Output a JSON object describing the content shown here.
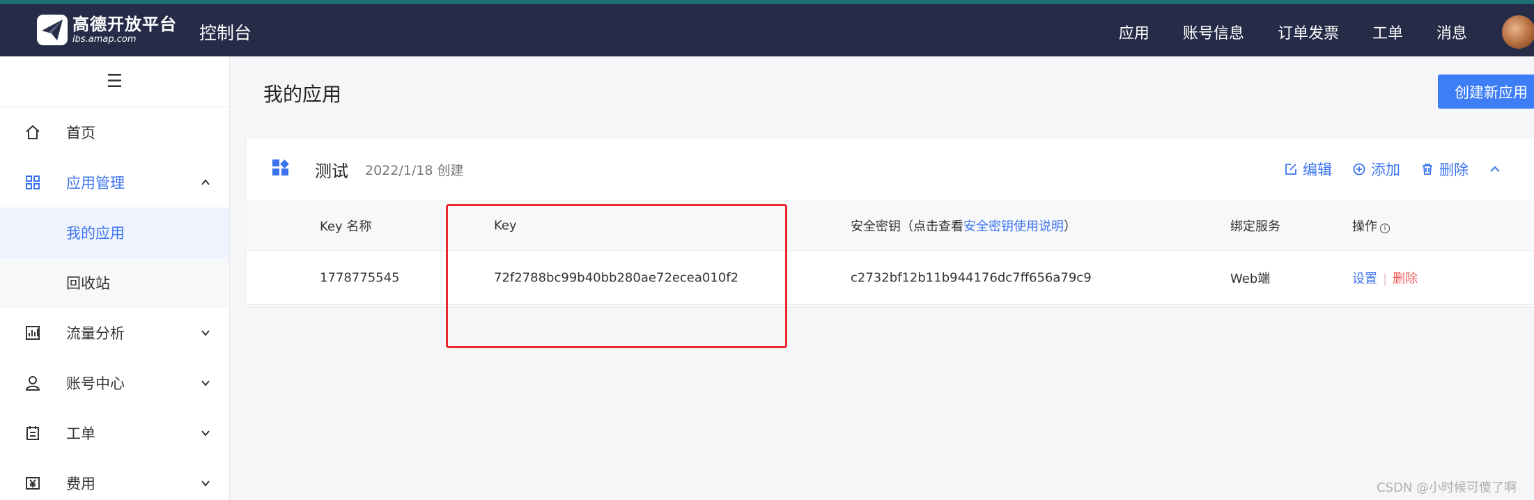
{
  "header": {
    "logo_cn": "高德开放平台",
    "logo_en": "lbs.amap.com",
    "console": "控制台",
    "nav": [
      "应用",
      "账号信息",
      "订单发票",
      "工单",
      "消息"
    ]
  },
  "sidebar": {
    "items": [
      {
        "label": "首页",
        "icon": "home-icon"
      },
      {
        "label": "应用管理",
        "icon": "apps-grid-icon"
      },
      {
        "label": "我的应用"
      },
      {
        "label": "回收站"
      },
      {
        "label": "流量分析",
        "icon": "chart-icon"
      },
      {
        "label": "账号中心",
        "icon": "user-icon"
      },
      {
        "label": "工单",
        "icon": "ticket-icon"
      },
      {
        "label": "费用",
        "icon": "yen-icon"
      }
    ]
  },
  "main": {
    "title": "我的应用",
    "create_label": "创建新应用",
    "app": {
      "name": "测试",
      "created": "2022/1/18 创建",
      "actions": {
        "edit": "编辑",
        "add": "添加",
        "delete": "删除"
      }
    },
    "table": {
      "headers": {
        "key_name": "Key 名称",
        "key": "Key",
        "secret_prefix": "安全密钥（点击查看",
        "secret_link": "安全密钥使用说明",
        "secret_suffix": "）",
        "service": "绑定服务",
        "ops": "操作"
      },
      "rows": [
        {
          "key_name": "1778775545",
          "key": "72f2788bc99b40bb280ae72ecea010f2",
          "secret": "c2732bf12b11b944176dc7ff656a79c9",
          "service": "Web端",
          "op_settings": "设置",
          "op_delete": "删除"
        }
      ]
    }
  },
  "watermark": "CSDN @小时候可傻了啊",
  "colors": {
    "header_bg": "#262c48",
    "accent": "#3c74f0",
    "highlight": "#e8292f"
  }
}
